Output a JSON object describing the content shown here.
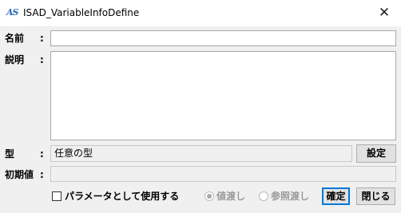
{
  "window": {
    "title": "ISAD_VariableInfoDefine",
    "icon_text": "AS",
    "close_glyph": "✕"
  },
  "form": {
    "name_label": "名前",
    "desc_label": "説明",
    "type_label": "型",
    "init_label": "初期値",
    "colon": ":",
    "name_value": "",
    "desc_value": "",
    "type_value": "任意の型",
    "init_value": ""
  },
  "buttons": {
    "set": "設定",
    "confirm": "確定",
    "close": "閉じる"
  },
  "options": {
    "use_as_param": "パラメータとして使用する",
    "use_as_param_checked": false,
    "by_value": "値渡し",
    "by_ref": "参照渡し",
    "selected": "by_value"
  }
}
